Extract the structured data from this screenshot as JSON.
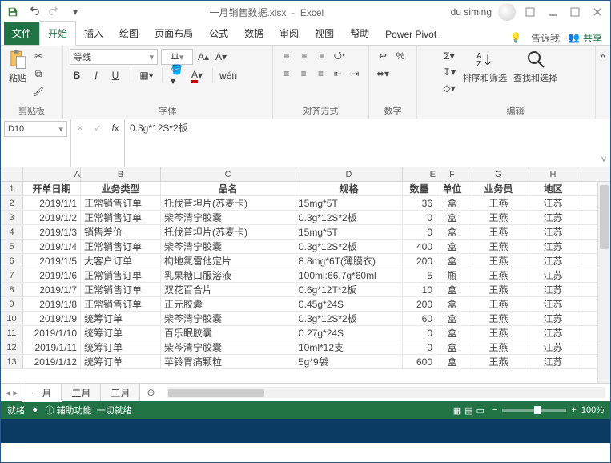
{
  "title": {
    "filename": "一月销售数据.xlsx",
    "app": "Excel",
    "user": "du siming"
  },
  "tabs": {
    "file": "文件",
    "home": "开始",
    "insert": "插入",
    "draw": "绘图",
    "pagelayout": "页面布局",
    "formulas": "公式",
    "data": "数据",
    "review": "审阅",
    "view": "视图",
    "help": "帮助",
    "powerpivot": "Power Pivot",
    "tellme": "告诉我",
    "share": "共享"
  },
  "ribbon": {
    "paste": "粘贴",
    "clipboard_label": "剪贴板",
    "font_name": "等线",
    "font_size": "11",
    "font_label": "字体",
    "align_label": "对齐方式",
    "number_label": "数字",
    "sort_filter": "排序和筛选",
    "find_select": "查找和选择",
    "editing_label": "编辑"
  },
  "formula_bar": {
    "cell_ref": "D10",
    "formula": "0.3g*12S*2板"
  },
  "columns": [
    "A",
    "B",
    "C",
    "D",
    "E",
    "F",
    "G",
    "H"
  ],
  "headers": {
    "A": "开单日期",
    "B": "业务类型",
    "C": "品名",
    "D": "规格",
    "E": "数量",
    "F": "单位",
    "G": "业务员",
    "H": "地区"
  },
  "rows": [
    {
      "n": 2,
      "A": "2019/1/1",
      "B": "正常销售订单",
      "C": "托伐普坦片(苏麦卡)",
      "D": "15mg*5T",
      "E": "36",
      "F": "盒",
      "G": "王燕",
      "H": "江苏"
    },
    {
      "n": 3,
      "A": "2019/1/2",
      "B": "正常销售订单",
      "C": "柴芩清宁胶囊",
      "D": "0.3g*12S*2板",
      "E": "0",
      "F": "盒",
      "G": "王燕",
      "H": "江苏"
    },
    {
      "n": 4,
      "A": "2019/1/3",
      "B": "销售差价",
      "C": "托伐普坦片(苏麦卡)",
      "D": "15mg*5T",
      "E": "0",
      "F": "盒",
      "G": "王燕",
      "H": "江苏"
    },
    {
      "n": 5,
      "A": "2019/1/4",
      "B": "正常销售订单",
      "C": "柴芩清宁胶囊",
      "D": "0.3g*12S*2板",
      "E": "400",
      "F": "盒",
      "G": "王燕",
      "H": "江苏"
    },
    {
      "n": 6,
      "A": "2019/1/5",
      "B": "大客户订单",
      "C": "枸地氯雷他定片",
      "D": "8.8mg*6T(薄膜衣)",
      "E": "200",
      "F": "盒",
      "G": "王燕",
      "H": "江苏"
    },
    {
      "n": 7,
      "A": "2019/1/6",
      "B": "正常销售订单",
      "C": "乳果糖口服溶液",
      "D": "100ml:66.7g*60ml",
      "E": "5",
      "F": "瓶",
      "G": "王燕",
      "H": "江苏"
    },
    {
      "n": 8,
      "A": "2019/1/7",
      "B": "正常销售订单",
      "C": "双花百合片",
      "D": "0.6g*12T*2板",
      "E": "10",
      "F": "盒",
      "G": "王燕",
      "H": "江苏"
    },
    {
      "n": 9,
      "A": "2019/1/8",
      "B": "正常销售订单",
      "C": "正元胶囊",
      "D": "0.45g*24S",
      "E": "200",
      "F": "盒",
      "G": "王燕",
      "H": "江苏"
    },
    {
      "n": 10,
      "A": "2019/1/9",
      "B": "统筹订单",
      "C": "柴芩清宁胶囊",
      "D": "0.3g*12S*2板",
      "E": "60",
      "F": "盒",
      "G": "王燕",
      "H": "江苏"
    },
    {
      "n": 11,
      "A": "2019/1/10",
      "B": "统筹订单",
      "C": "百乐眠胶囊",
      "D": "0.27g*24S",
      "E": "0",
      "F": "盒",
      "G": "王燕",
      "H": "江苏"
    },
    {
      "n": 12,
      "A": "2019/1/11",
      "B": "统筹订单",
      "C": "柴芩清宁胶囊",
      "D": "10ml*12支",
      "E": "0",
      "F": "盒",
      "G": "王燕",
      "H": "江苏"
    },
    {
      "n": 13,
      "A": "2019/1/12",
      "B": "统筹订单",
      "C": "苹铃胃痛颗粒",
      "D": "5g*9袋",
      "E": "600",
      "F": "盒",
      "G": "王燕",
      "H": "江苏"
    }
  ],
  "sheet_tabs": {
    "s1": "一月",
    "s2": "二月",
    "s3": "三月"
  },
  "status": {
    "ready": "就绪",
    "accessibility": "辅助功能: 一切就绪",
    "zoom": "100%"
  }
}
